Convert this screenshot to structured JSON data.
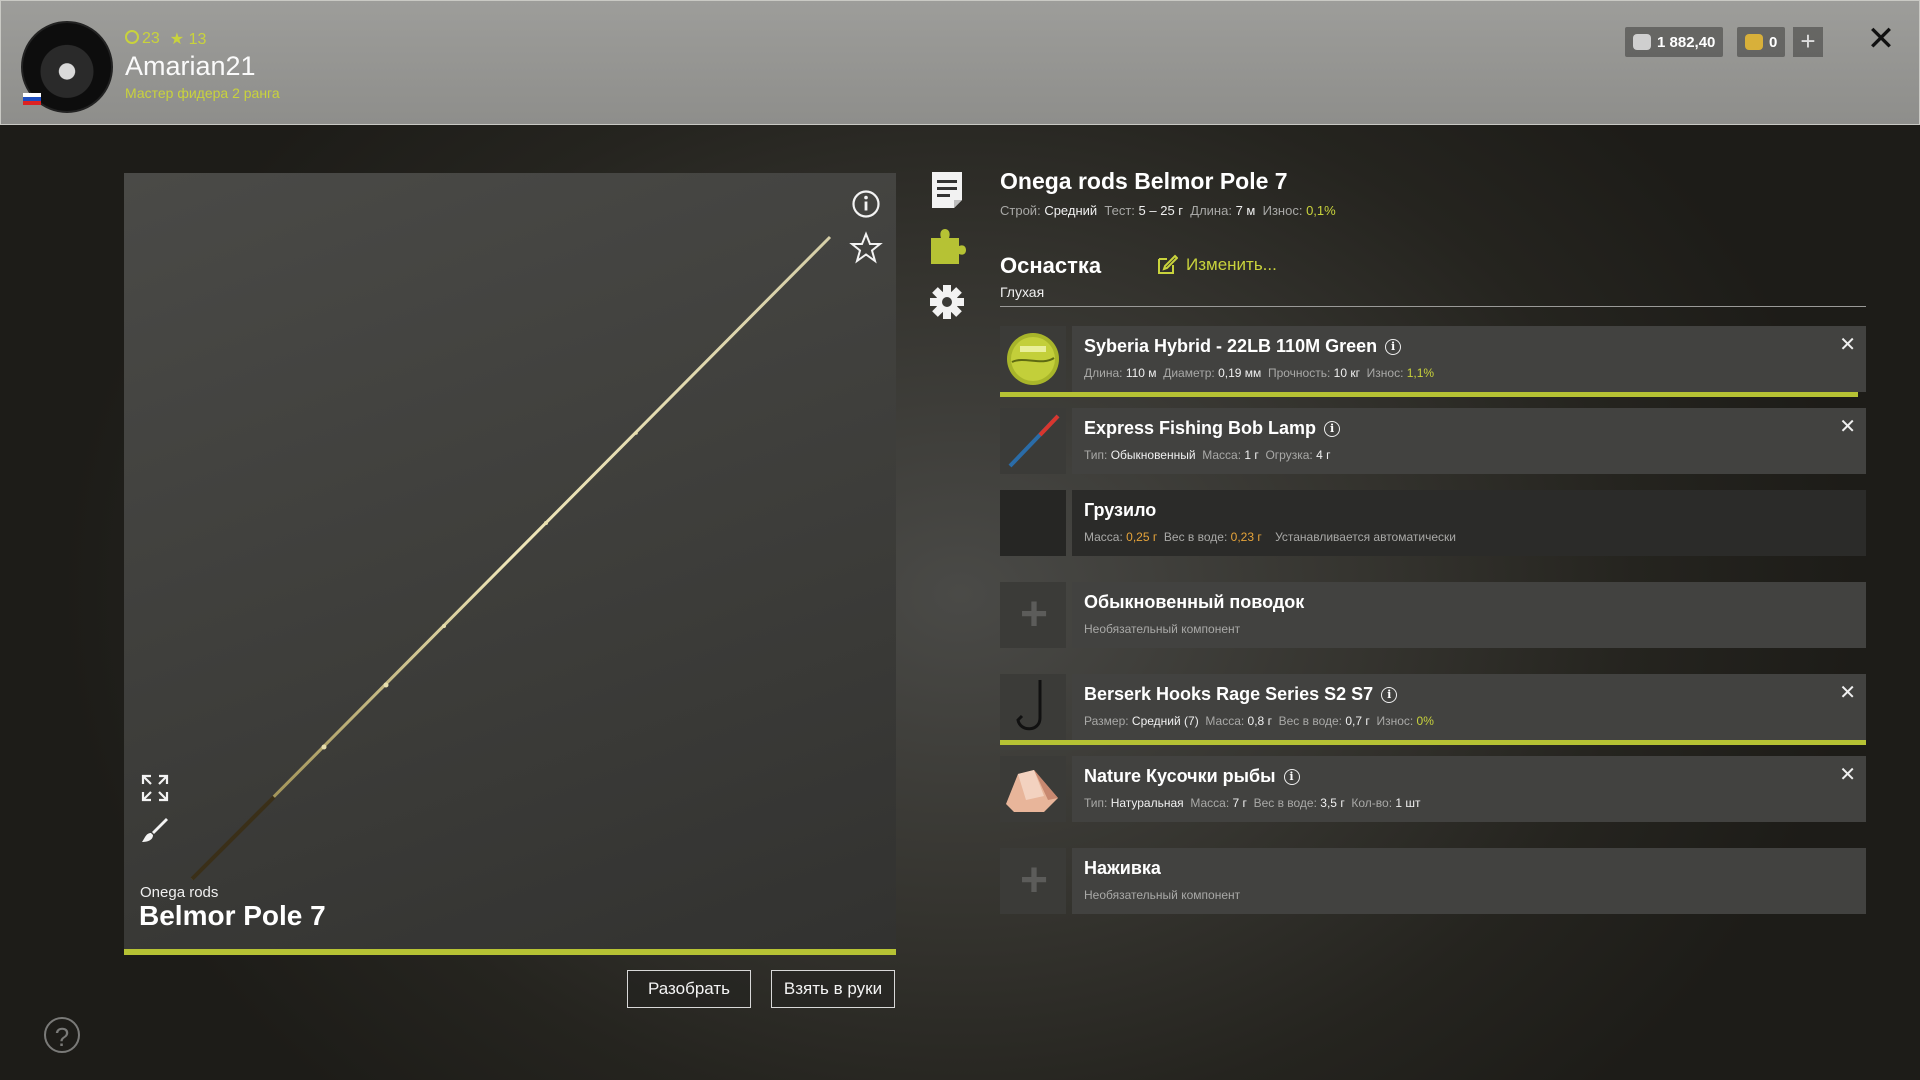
{
  "header": {
    "level": "23",
    "stars": "13",
    "username": "Amarian21",
    "rank": "Мастер фидера 2 ранга",
    "silver": "1 882,40",
    "gold": "0",
    "plus": "+",
    "close": "✕"
  },
  "rod": {
    "brand": "Onega rods",
    "name": "Belmor Pole 7"
  },
  "buttons": {
    "disassemble": "Разобрать",
    "take": "Взять в руки"
  },
  "help": "?",
  "item": {
    "title": "Onega rods Belmor Pole 7",
    "specs": {
      "action_label": "Строй:",
      "action": "Средний",
      "test_label": "Тест:",
      "test": "5 – 25 г",
      "length_label": "Длина:",
      "length": "7 м",
      "wear_label": "Износ:",
      "wear": "0,1%"
    }
  },
  "rig": {
    "heading": "Оснастка",
    "type": "Глухая",
    "edit": "Изменить..."
  },
  "components": [
    {
      "name": "Syberia Hybrid - 22LB 110M Green",
      "l1": "Длина:",
      "v1": "110 м",
      "l2": "Диаметр:",
      "v2": "0,19 мм",
      "l3": "Прочность:",
      "v3": "10 кг",
      "l4": "Износ:",
      "v4": "1,1%"
    },
    {
      "name": "Express Fishing Bob Lamp",
      "l1": "Тип:",
      "v1": "Обыкновенный",
      "l2": "Масса:",
      "v2": "1 г",
      "l3": "Огрузка:",
      "v3": "4 г"
    },
    {
      "name": "Грузило",
      "l1": "Масса:",
      "v1": "0,25 г",
      "l2": "Вес в воде:",
      "v2": "0,23 г",
      "note": "Устанавливается автоматически"
    },
    {
      "name": "Обыкновенный поводок",
      "note": "Необязательный компонент"
    },
    {
      "name": "Berserk Hooks Rage Series S2 S7",
      "l1": "Размер:",
      "v1": "Средний (7)",
      "l2": "Масса:",
      "v2": "0,8 г",
      "l3": "Вес в воде:",
      "v3": "0,7 г",
      "l4": "Износ:",
      "v4": "0%"
    },
    {
      "name": "Nature Кусочки рыбы",
      "l1": "Тип:",
      "v1": "Натуральная",
      "l2": "Масса:",
      "v2": "7 г",
      "l3": "Вес в воде:",
      "v3": "3,5 г",
      "l4": "Кол-во:",
      "v4": "1 шт"
    },
    {
      "name": "Наживка",
      "note": "Необязательный компонент"
    }
  ],
  "colors": {
    "accent": "#b6c234",
    "highlight": "#c9d33c",
    "warning": "#e6a43a"
  }
}
